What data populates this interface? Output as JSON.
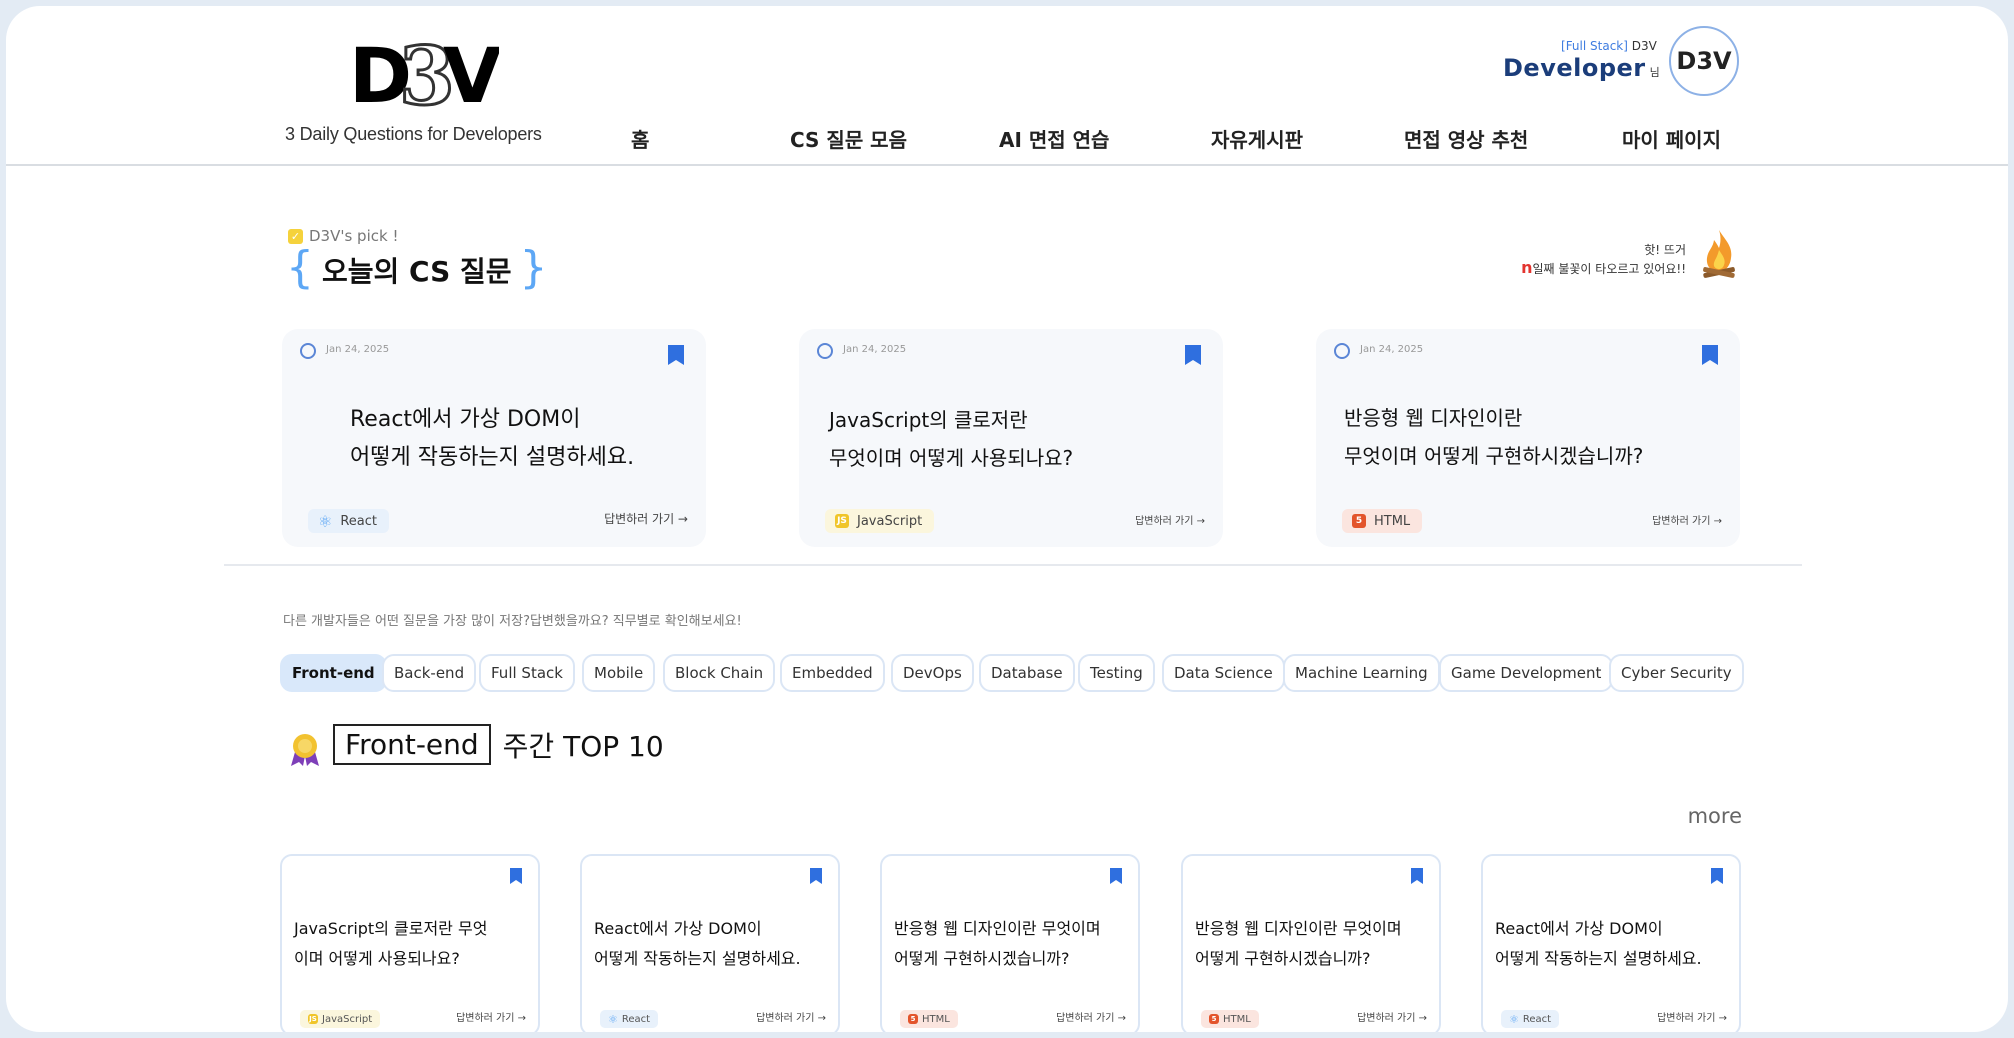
{
  "header": {
    "logo_text": "D3V",
    "tagline": "3 Daily Questions for Developers",
    "nav": [
      "홈",
      "CS 질문 모음",
      "AI 면접 연습",
      "자유게시판",
      "면접 영상 추천",
      "마이 페이지"
    ],
    "profile": {
      "position": "Full Stack",
      "site": "D3V",
      "nickname": "Developer",
      "honorific": "님",
      "avatar_text": "D3V"
    }
  },
  "today": {
    "pick_label": "D3V's pick !",
    "title": "오늘의 CS 질문",
    "streak_line1": "핫! 뜨거",
    "streak_n": "n",
    "streak_line2": "일째 불꽃이 타오르고 있어요!!",
    "cards": [
      {
        "date": "Jan 24, 2025",
        "line1": "React에서 가상 DOM이",
        "line2": "어떻게 작동하는지 설명하세요.",
        "tag": "React",
        "go": "답변하러 가기 →"
      },
      {
        "date": "Jan 24, 2025",
        "line1": "JavaScript의 클로저란",
        "line2": "무엇이며 어떻게 사용되나요?",
        "tag": "JavaScript",
        "go": "답변하러 가기 →"
      },
      {
        "date": "Jan 24, 2025",
        "line1": "반응형 웹 디자인이란",
        "line2": "무엇이며 어떻게 구현하시겠습니까?",
        "tag": "HTML",
        "go": "답변하러 가기 →"
      }
    ]
  },
  "ranking": {
    "hint": "다른 개발자들은 어떤 질문을 가장 많이 저장?답변했을까요? 직무별로 확인해보세요!",
    "chips": [
      "Front-end",
      "Back-end",
      "Full Stack",
      "Mobile",
      "Block Chain",
      "Embedded",
      "DevOps",
      "Database",
      "Testing",
      "Data Science",
      "Machine Learning",
      "Game Development",
      "Cyber Security"
    ],
    "selected": "Front-end",
    "title_suffix": "주간 TOP 10",
    "more": "more",
    "cards": [
      {
        "line1": "JavaScript의 클로저란 무엇",
        "line2": "이며 어떻게 사용되나요?",
        "tag": "JavaScript",
        "go": "답변하러 가기 →"
      },
      {
        "line1": "React에서 가상 DOM이",
        "line2": "어떻게 작동하는지 설명하세요.",
        "tag": "React",
        "go": "답변하러 가기 →"
      },
      {
        "line1": "반응형 웹 디자인이란 무엇이며",
        "line2": "어떻게 구현하시겠습니까?",
        "tag": "HTML",
        "go": "답변하러 가기 →"
      },
      {
        "line1": "반응형 웹 디자인이란 무엇이며",
        "line2": "어떻게 구현하시겠습니까?",
        "tag": "HTML",
        "go": "답변하러 가기 →"
      },
      {
        "line1": "React에서 가상 DOM이",
        "line2": "어떻게 작동하는지 설명하세요.",
        "tag": "React",
        "go": "답변하러 가기 →"
      }
    ]
  },
  "colors": {
    "accent": "#2f6fdf",
    "brace": "#5da7f5",
    "chip_active": "#d9e8fa",
    "react_tag": "#e8f1fb",
    "js_tag": "#fbf6dd",
    "html_tag": "#fbe5df"
  },
  "icons": [
    "calendar-icon",
    "bookmark-icon",
    "fire-icon",
    "medal-icon",
    "react-icon",
    "javascript-icon",
    "html5-icon",
    "check-icon"
  ]
}
